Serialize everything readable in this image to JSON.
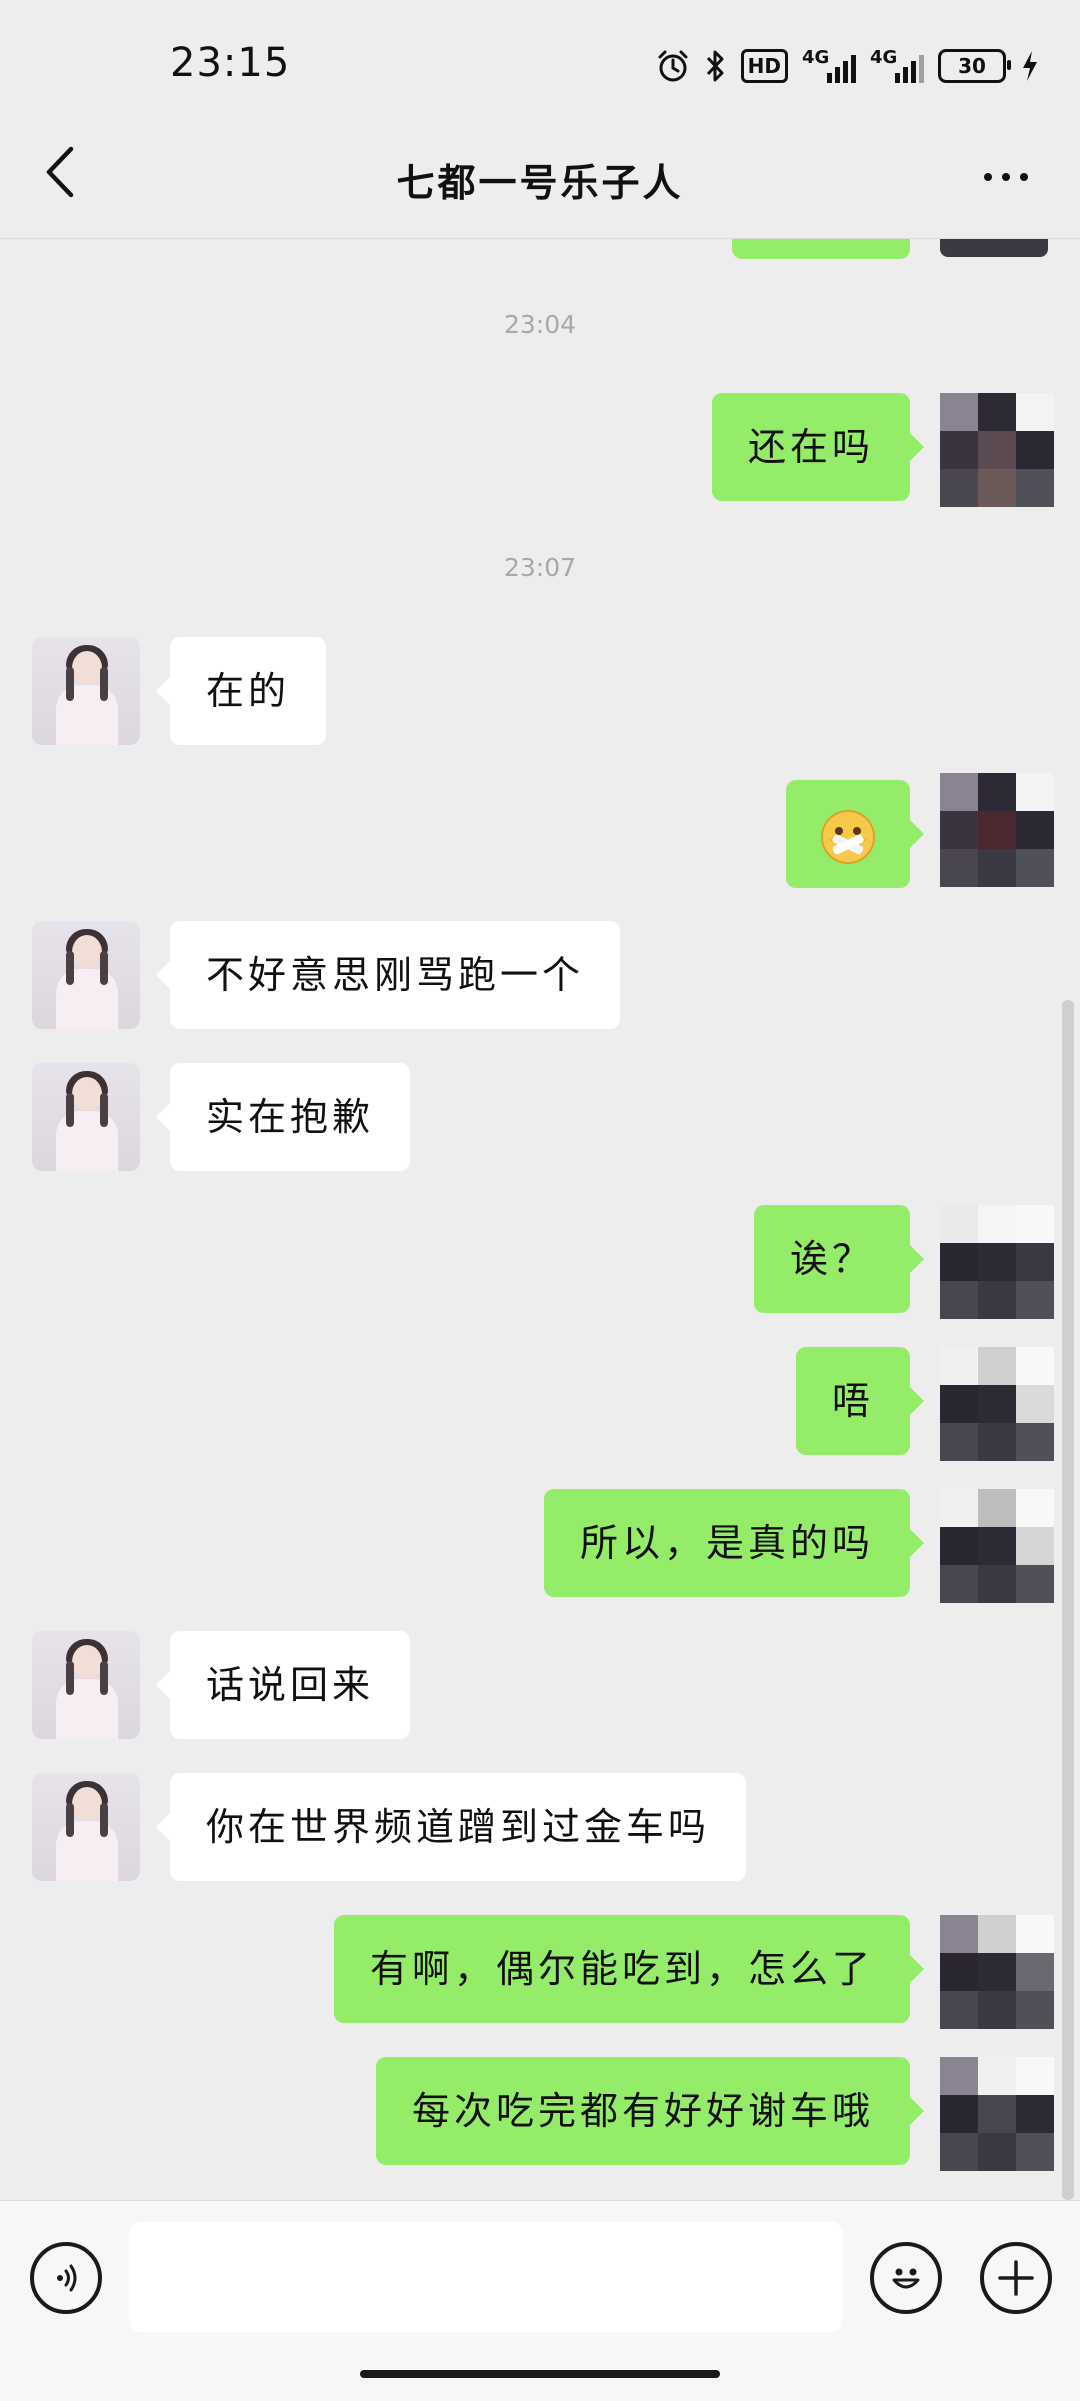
{
  "status_bar": {
    "time": "23:15",
    "hd_label": "HD",
    "net1_label": "4G",
    "net2_label": "4G",
    "battery_level": "30"
  },
  "header": {
    "title": "七都一号乐子人"
  },
  "timestamps": [
    "23:04",
    "23:07"
  ],
  "messages": [
    {
      "from": "me",
      "text": "还在吗"
    },
    {
      "from": "her",
      "text": "在的"
    },
    {
      "from": "me",
      "text": "",
      "emoji": "zipper-mouth-face-emoji"
    },
    {
      "from": "her",
      "text": "不好意思刚骂跑一个"
    },
    {
      "from": "her",
      "text": "实在抱歉"
    },
    {
      "from": "me",
      "text": "诶？"
    },
    {
      "from": "me",
      "text": "唔"
    },
    {
      "from": "me",
      "text": "所以，是真的吗"
    },
    {
      "from": "her",
      "text": "话说回来"
    },
    {
      "from": "her",
      "text": "你在世界频道蹭到过金车吗"
    },
    {
      "from": "me",
      "text": "有啊，偶尔能吃到，怎么了"
    },
    {
      "from": "me",
      "text": "每次吃完都有好好谢车哦"
    }
  ],
  "input_bar": {
    "placeholder": ""
  },
  "colors": {
    "background": "#EDEDED",
    "outgoing_bubble": "#95EC69",
    "incoming_bubble": "#FFFFFF",
    "timestamp": "#A8A8A8"
  },
  "icons": [
    "alarm-icon",
    "bluetooth-icon",
    "signal-icon",
    "battery-icon",
    "charging-icon",
    "back-arrow-icon",
    "more-icon",
    "voice-icon",
    "emoji-icon",
    "plus-icon"
  ]
}
